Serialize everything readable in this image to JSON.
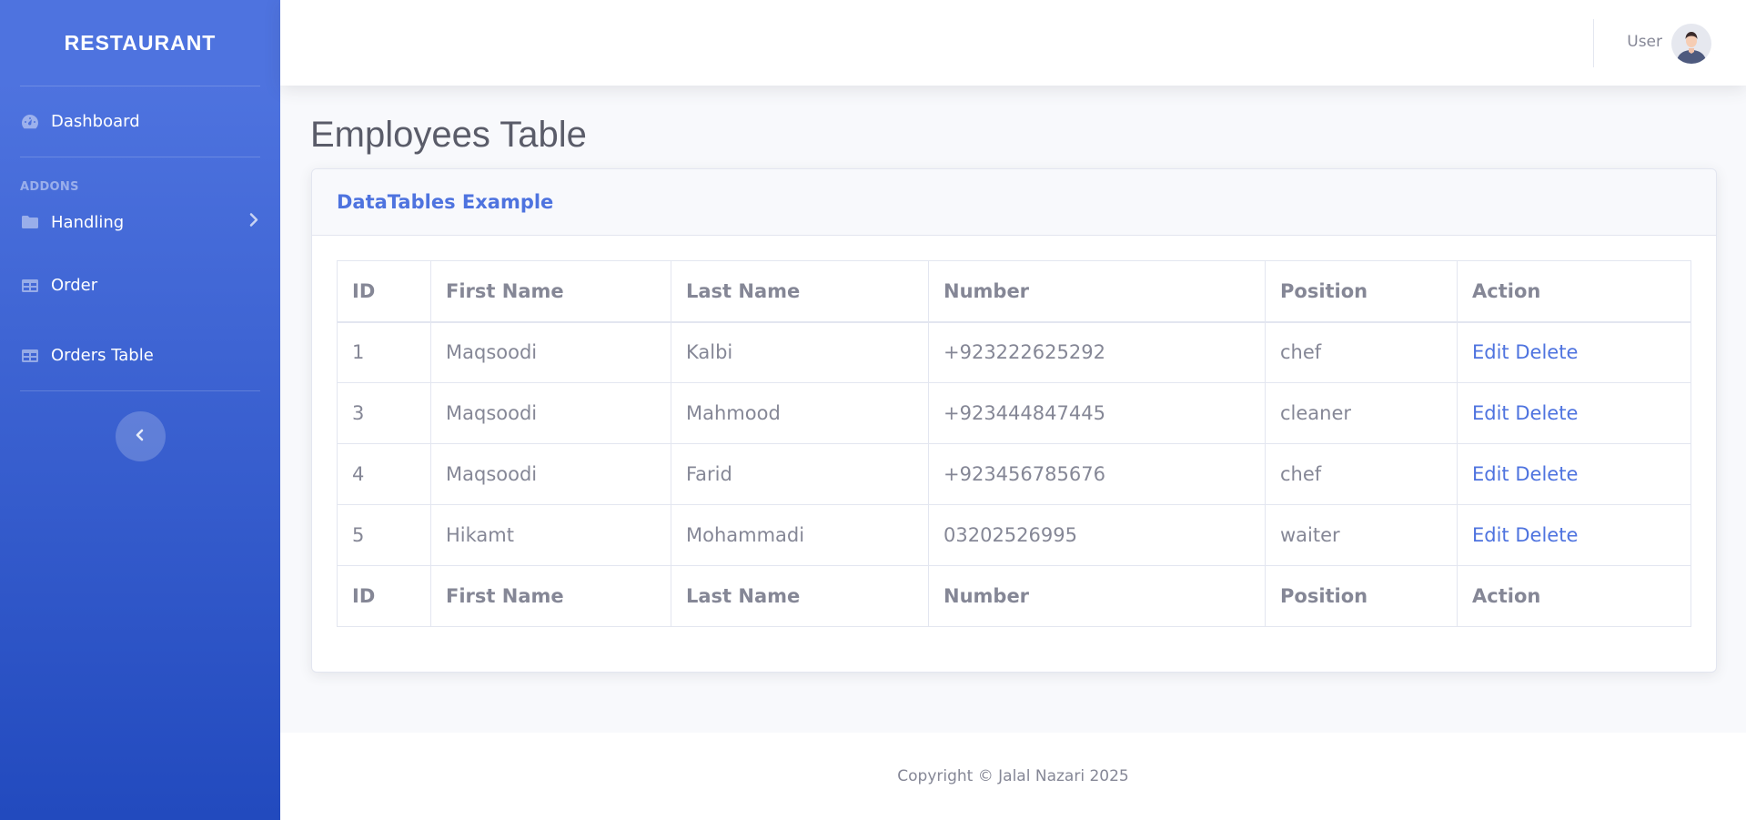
{
  "sidebar": {
    "brand": "RESTAURANT",
    "items": [
      {
        "label": "Dashboard",
        "icon": "tachometer-icon"
      },
      {
        "label": "Handling",
        "icon": "folder-icon"
      },
      {
        "label": "Order",
        "icon": "table-icon"
      },
      {
        "label": "Orders Table",
        "icon": "table-icon"
      }
    ],
    "heading_addons": "ADDONS",
    "toggle_icon": "chevron-left-icon"
  },
  "topbar": {
    "user_name": "User",
    "avatar_icon": "user-avatar"
  },
  "main": {
    "page_title": "Employees Table",
    "card_title": "DataTables Example",
    "table": {
      "columns": [
        "ID",
        "First Name",
        "Last Name",
        "Number",
        "Position",
        "Action"
      ],
      "rows": [
        {
          "id": "1",
          "first": "Maqsoodi",
          "last": "Kalbi",
          "number": "+923222625292",
          "position": "chef",
          "edit": "Edit",
          "delete": "Delete"
        },
        {
          "id": "3",
          "first": "Maqsoodi",
          "last": "Mahmood",
          "number": "+923444847445",
          "position": "cleaner",
          "edit": "Edit",
          "delete": "Delete"
        },
        {
          "id": "4",
          "first": "Maqsoodi",
          "last": "Farid",
          "number": "+923456785676",
          "position": "chef",
          "edit": "Edit",
          "delete": "Delete"
        },
        {
          "id": "5",
          "first": "Hikamt",
          "last": "Mohammadi",
          "number": "03202526995",
          "position": "waiter",
          "edit": "Edit",
          "delete": "Delete"
        }
      ]
    }
  },
  "footer": {
    "copyright": "Copyright © Jalal Nazari 2025"
  },
  "colors": {
    "primary": "#4e73df",
    "sidebar_gradient_end": "#224abe",
    "text_muted": "#858796",
    "title": "#5a5c69"
  }
}
